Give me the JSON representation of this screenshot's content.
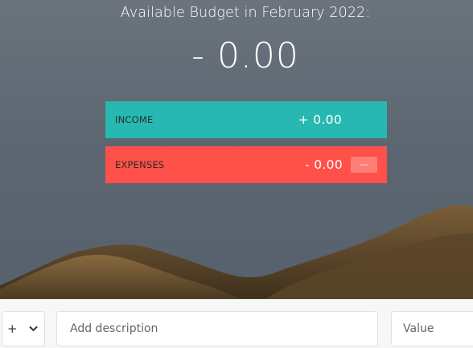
{
  "budget": {
    "title": "Available Budget in February 2022:",
    "value": "- 0.00"
  },
  "income": {
    "label": "Income",
    "value": "+ 0.00",
    "color": "#27b9b1"
  },
  "expenses": {
    "label": "Expenses",
    "value": "- 0.00",
    "percentage": "---",
    "color": "#ff5049"
  },
  "add_form": {
    "type_selected": "+",
    "description_placeholder": "Add description",
    "value_placeholder": "Value"
  }
}
